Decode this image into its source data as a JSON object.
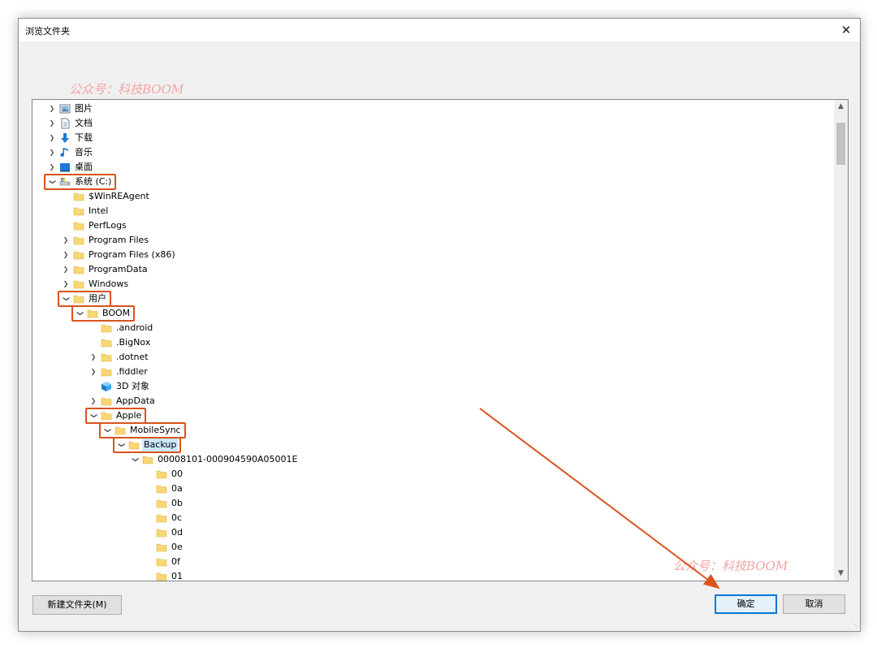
{
  "window": {
    "title": "浏览文件夹",
    "close_glyph": "✕"
  },
  "watermark": "公众号：科技BOOM",
  "tree": [
    {
      "label": "图片",
      "depth": 0,
      "chevron": "right",
      "icon": "pictures-icon"
    },
    {
      "label": "文档",
      "depth": 0,
      "chevron": "right",
      "icon": "documents-icon"
    },
    {
      "label": "下载",
      "depth": 0,
      "chevron": "right",
      "icon": "downloads-icon"
    },
    {
      "label": "音乐",
      "depth": 0,
      "chevron": "right",
      "icon": "music-icon"
    },
    {
      "label": "桌面",
      "depth": 0,
      "chevron": "right",
      "icon": "desktop-icon"
    },
    {
      "label": "系统 (C:)",
      "depth": 0,
      "chevron": "down",
      "icon": "drive-icon",
      "highlight": true
    },
    {
      "label": "$WinREAgent",
      "depth": 1,
      "chevron": "none",
      "icon": "folder-icon"
    },
    {
      "label": "Intel",
      "depth": 1,
      "chevron": "none",
      "icon": "folder-icon"
    },
    {
      "label": "PerfLogs",
      "depth": 1,
      "chevron": "none",
      "icon": "folder-icon"
    },
    {
      "label": "Program Files",
      "depth": 1,
      "chevron": "right",
      "icon": "folder-icon"
    },
    {
      "label": "Program Files (x86)",
      "depth": 1,
      "chevron": "right",
      "icon": "folder-icon"
    },
    {
      "label": "ProgramData",
      "depth": 1,
      "chevron": "right",
      "icon": "folder-icon"
    },
    {
      "label": "Windows",
      "depth": 1,
      "chevron": "right",
      "icon": "folder-icon"
    },
    {
      "label": "用户",
      "depth": 1,
      "chevron": "down",
      "icon": "folder-icon",
      "highlight": true
    },
    {
      "label": "BOOM",
      "depth": 2,
      "chevron": "down",
      "icon": "folder-icon",
      "highlight": true
    },
    {
      "label": ".android",
      "depth": 3,
      "chevron": "none",
      "icon": "folder-icon"
    },
    {
      "label": ".BigNox",
      "depth": 3,
      "chevron": "none",
      "icon": "folder-icon"
    },
    {
      "label": ".dotnet",
      "depth": 3,
      "chevron": "right",
      "icon": "folder-icon"
    },
    {
      "label": ".fiddler",
      "depth": 3,
      "chevron": "right",
      "icon": "folder-icon"
    },
    {
      "label": "3D 对象",
      "depth": 3,
      "chevron": "none",
      "icon": "3d-objects-icon"
    },
    {
      "label": "AppData",
      "depth": 3,
      "chevron": "right",
      "icon": "folder-icon"
    },
    {
      "label": "Apple",
      "depth": 3,
      "chevron": "down",
      "icon": "folder-icon",
      "highlight": true
    },
    {
      "label": "MobileSync",
      "depth": 4,
      "chevron": "down",
      "icon": "folder-icon",
      "highlight": true
    },
    {
      "label": "Backup",
      "depth": 5,
      "chevron": "down",
      "icon": "folder-icon",
      "highlight": true,
      "selected": true
    },
    {
      "label": "00008101-000904590A05001E",
      "depth": 6,
      "chevron": "down",
      "icon": "folder-icon"
    },
    {
      "label": "00",
      "depth": 7,
      "chevron": "none",
      "icon": "folder-icon"
    },
    {
      "label": "0a",
      "depth": 7,
      "chevron": "none",
      "icon": "folder-icon"
    },
    {
      "label": "0b",
      "depth": 7,
      "chevron": "none",
      "icon": "folder-icon"
    },
    {
      "label": "0c",
      "depth": 7,
      "chevron": "none",
      "icon": "folder-icon"
    },
    {
      "label": "0d",
      "depth": 7,
      "chevron": "none",
      "icon": "folder-icon"
    },
    {
      "label": "0e",
      "depth": 7,
      "chevron": "none",
      "icon": "folder-icon"
    },
    {
      "label": "0f",
      "depth": 7,
      "chevron": "none",
      "icon": "folder-icon"
    },
    {
      "label": "01",
      "depth": 7,
      "chevron": "none",
      "icon": "folder-icon"
    }
  ],
  "buttons": {
    "new_folder": "新建文件夹(M)",
    "ok": "确定",
    "cancel": "取消"
  },
  "colors": {
    "highlight_box": "#d9531e",
    "arrow": "#d9531e",
    "watermark": "#f4a3a3",
    "folder": "#f8d775",
    "selection": "#cce8ff",
    "default_button_border": "#0078d7"
  }
}
